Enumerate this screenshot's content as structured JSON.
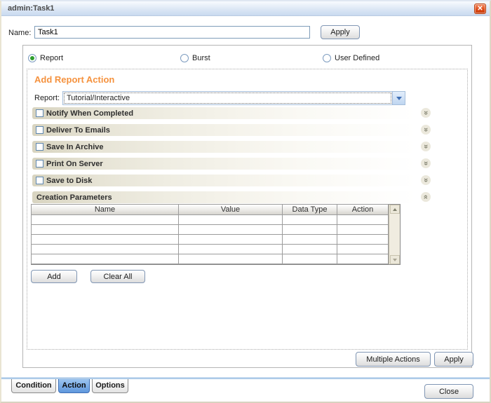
{
  "window": {
    "title": "admin:Task1",
    "close_icon": "x"
  },
  "name_field": {
    "label": "Name:",
    "value": "Task1",
    "apply_label": "Apply"
  },
  "action_types": [
    {
      "label": "Report",
      "selected": true
    },
    {
      "label": "Burst",
      "selected": false
    },
    {
      "label": "User Defined",
      "selected": false
    }
  ],
  "panel_heading": "Add Report Action",
  "report_select": {
    "label": "Report:",
    "value": "Tutorial/Interactive"
  },
  "sections": [
    {
      "label": "Notify When Completed",
      "has_checkbox": true,
      "checked": false,
      "state": "collapsed"
    },
    {
      "label": "Deliver To Emails",
      "has_checkbox": true,
      "checked": false,
      "state": "collapsed"
    },
    {
      "label": "Save In Archive",
      "has_checkbox": true,
      "checked": false,
      "state": "collapsed"
    },
    {
      "label": "Print On Server",
      "has_checkbox": true,
      "checked": false,
      "state": "collapsed"
    },
    {
      "label": "Save to Disk",
      "has_checkbox": true,
      "checked": false,
      "state": "collapsed"
    },
    {
      "label": "Creation Parameters",
      "has_checkbox": false,
      "state": "expanded"
    }
  ],
  "parameters_table": {
    "columns": [
      "Name",
      "Value",
      "Data Type",
      "Action"
    ],
    "rows": [
      [
        "",
        "",
        "",
        ""
      ],
      [
        "",
        "",
        "",
        ""
      ],
      [
        "",
        "",
        "",
        ""
      ],
      [
        "",
        "",
        "",
        ""
      ],
      [
        "",
        "",
        "",
        ""
      ]
    ]
  },
  "table_buttons": {
    "add": "Add",
    "clear_all": "Clear All"
  },
  "footer_buttons": {
    "multiple_actions": "Multiple Actions",
    "apply": "Apply"
  },
  "tabs": [
    {
      "label": "Condition",
      "selected": false
    },
    {
      "label": "Action",
      "selected": true
    },
    {
      "label": "Options",
      "selected": false
    }
  ],
  "close_button_label": "Close",
  "colors": {
    "accent_orange": "#f5923e",
    "titlebar_blue": "#c9daf0",
    "close_red": "#dd4814",
    "selected_tab_blue": "#5f97dd",
    "section_bar_tan": "#d8d4c0"
  }
}
